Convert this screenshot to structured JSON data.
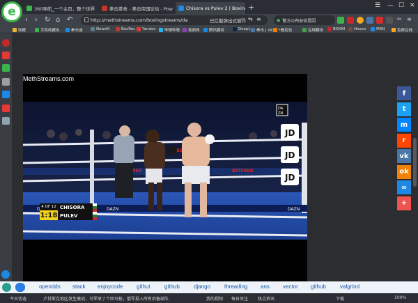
{
  "browser": {
    "logo_glyph": "e",
    "tabs": [
      {
        "label": "360导航_一个主页，整个世界",
        "fav_color": "#3ab54a"
      },
      {
        "label": "拳击茶舍 - 拳击帝国论坛 - Pow",
        "fav_color": "#c0392b"
      },
      {
        "label": "https://methstreams.com/boxingstreams/da",
        "fav_color": "#888888"
      },
      {
        "label": "Chisora vs Pulev 2 | Boxing",
        "fav_color": "#1e88e5"
      }
    ],
    "new_tab_icon": "plus-icon",
    "window_controls": [
      "☐",
      "—",
      "☐",
      "✕"
    ],
    "url": "http://methstreams.com/boxingstreams/da",
    "in_bar_text": "已拦截弹出式窗口",
    "search_text": "警方公布安倍晃因",
    "more_icon": "»"
  },
  "bookmarks": [
    {
      "label": "收藏",
      "color": "#f0b429"
    },
    {
      "label": "手机收藏夹",
      "color": "#3ab54a"
    },
    {
      "label": "拳击迷",
      "color": "#1e88e5"
    },
    {
      "label": "NewsN",
      "color": "#607d8b"
    },
    {
      "label": "BoxRec",
      "color": "#c0392b"
    },
    {
      "label": "Yandex",
      "color": "#e53935"
    },
    {
      "label": "哔哩哔哩",
      "color": "#29b6f6"
    },
    {
      "label": "视频网",
      "color": "#8e44ad"
    },
    {
      "label": "腾讯翻译",
      "color": "#1e88e5"
    },
    {
      "label": "DeepL",
      "color": "#0f2b46"
    },
    {
      "label": "拳击 | VK",
      "color": "#4a76a8"
    },
    {
      "label": "*看招也",
      "color": "#f57c00"
    },
    {
      "label": "在线翻译",
      "color": "#43a047"
    },
    {
      "label": "BOXIN",
      "color": "#c62828"
    },
    {
      "label": "Hosoo",
      "color": "#6d4c41"
    },
    {
      "label": "MSN",
      "color": "#1e88e5"
    },
    {
      "label": "免费在线",
      "color": "#f9a825"
    }
  ],
  "player": {
    "watermark": "MethStreams.com",
    "dazn": "DAZN",
    "ring_sponsor": "BETFRED",
    "jd_logo": "JD"
  },
  "scoreboard": {
    "round": "4 OF 12",
    "clock": "1:18",
    "fighter1": "CHISORA",
    "fighter2": "PULEV"
  },
  "share": [
    {
      "icon": "facebook-icon",
      "glyph": "f",
      "color": "#3b5998"
    },
    {
      "icon": "twitter-icon",
      "glyph": "t",
      "color": "#1da1f2"
    },
    {
      "icon": "messenger-icon",
      "glyph": "m",
      "color": "#0084ff"
    },
    {
      "icon": "reddit-icon",
      "glyph": "r",
      "color": "#ff4500"
    },
    {
      "icon": "vk-icon",
      "glyph": "vk",
      "color": "#4a76a8"
    },
    {
      "icon": "odnoklassniki-icon",
      "glyph": "ok",
      "color": "#ee8208"
    },
    {
      "icon": "link-icon",
      "glyph": "∞",
      "color": "#1e88e5"
    },
    {
      "icon": "more-icon",
      "glyph": "+",
      "color": "#ef5350"
    }
  ],
  "tagbar": {
    "items": [
      "opendds",
      "stack",
      "enjoycode",
      "githut",
      "github",
      "django",
      "threading",
      "ans",
      "vector",
      "github",
      "valgrind"
    ]
  },
  "status": {
    "left": "今日优选",
    "headline": "卢甘斯克地区发生激战，乌军承了个回马枪，俄军投入所有后备部队",
    "my_view": "我的视频",
    "hot": "每日关注",
    "news": "热点资讯",
    "download": "下载",
    "zoom": "100%"
  },
  "colors": {
    "accent": "#3ab54a",
    "tag_link": "#1a5aa8",
    "scoreboard_yellow": "#f3d21c",
    "scoreboard_black": "#111111"
  }
}
